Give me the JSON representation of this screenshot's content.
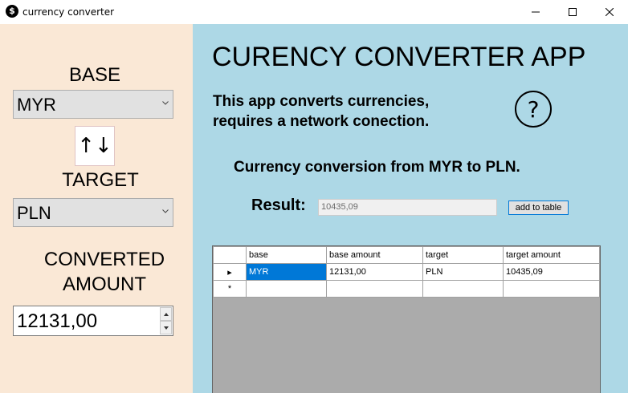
{
  "window": {
    "title": "currency converter",
    "icon_glyph": "$",
    "buttons": [
      "minimize-icon",
      "maximize-icon",
      "close-icon"
    ]
  },
  "left": {
    "base_label": "BASE",
    "base_value": "MYR",
    "swap_glyph": "↑↓",
    "target_label": "TARGET",
    "target_value": "PLN",
    "converted_label_line1": "CONVERTED",
    "converted_label_line2": "AMOUNT",
    "amount_value": "12131,00"
  },
  "main": {
    "app_title": "CURENCY CONVERTER APP",
    "description_line1": "This app converts currencies,",
    "description_line2": "requires a network conection.",
    "help_glyph": "?",
    "conversion_message": "Currency conversion from MYR to PLN.",
    "result_label": "Result:",
    "result_value": "10435,09",
    "add_button_label": "add to table"
  },
  "table": {
    "columns": [
      "base",
      "base amount",
      "target",
      "target amount"
    ],
    "rows": [
      [
        "MYR",
        "12131,00",
        "PLN",
        "10435,09"
      ]
    ],
    "current_row_glyph": "▸",
    "new_row_glyph": "*"
  },
  "colors": {
    "left_panel_bg": "#fae8d6",
    "right_panel_bg": "#add8e6",
    "selection": "#0078d7",
    "grid_bg": "#ababab"
  }
}
